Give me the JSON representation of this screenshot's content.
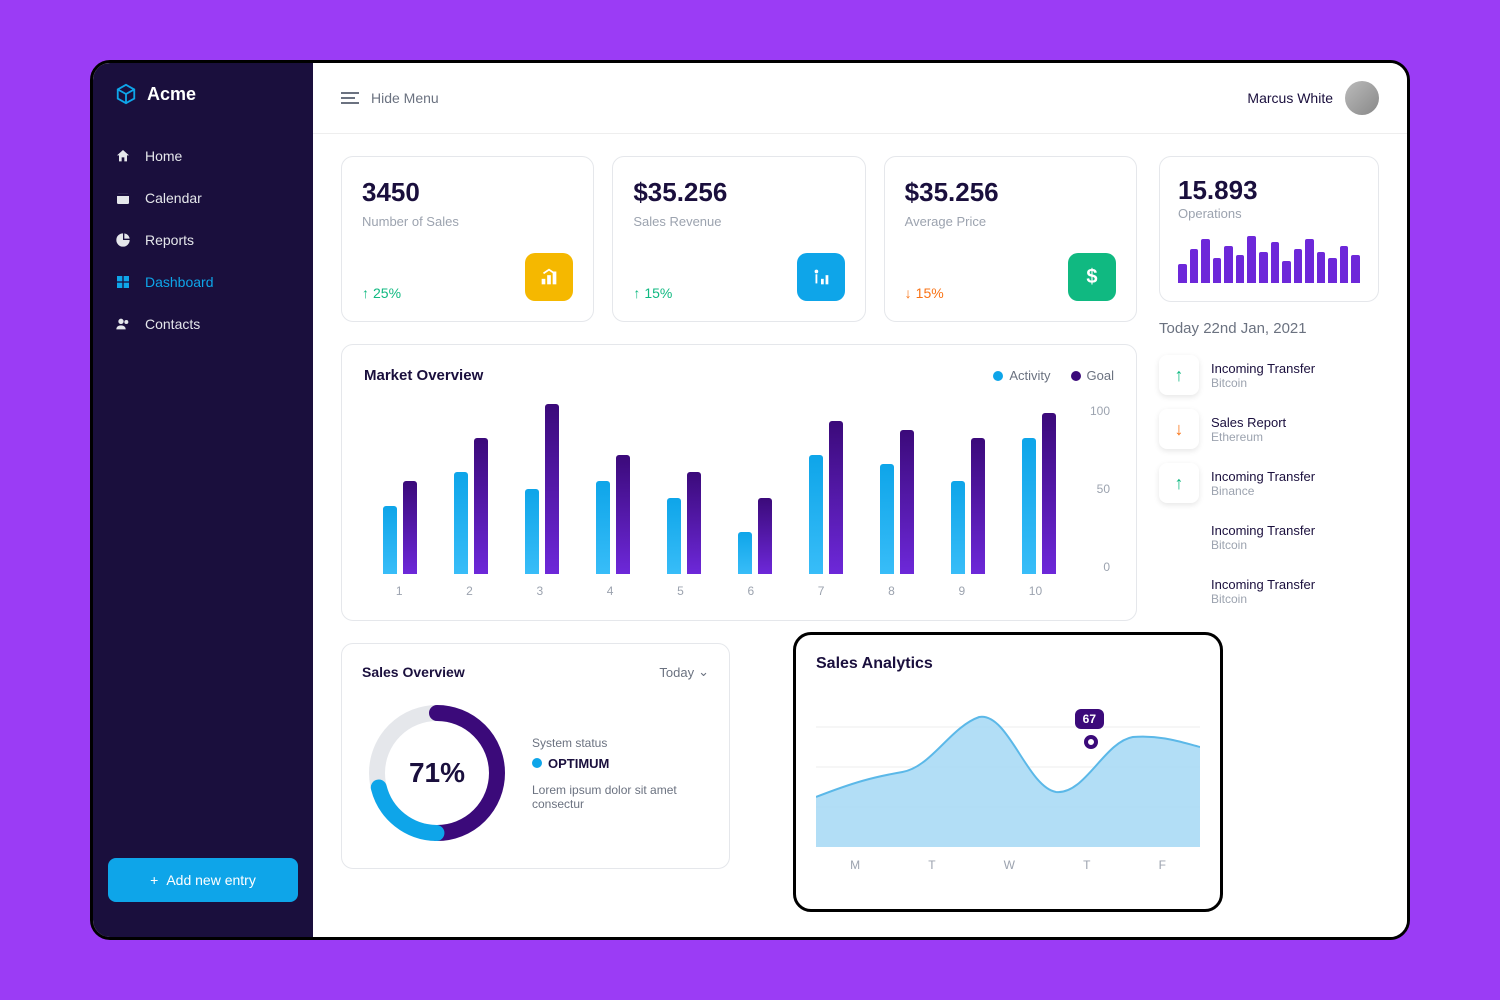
{
  "brand": "Acme",
  "hide_menu": "Hide Menu",
  "user_name": "Marcus White",
  "nav": {
    "home": "Home",
    "calendar": "Calendar",
    "reports": "Reports",
    "dashboard": "Dashboard",
    "contacts": "Contacts"
  },
  "add_button": "Add new entry",
  "cards": [
    {
      "value": "3450",
      "label": "Number of Sales",
      "trend": "25%",
      "trend_dir": "up",
      "icon_bg": "#f5b800"
    },
    {
      "value": "$35.256",
      "label": "Sales Revenue",
      "trend": "15%",
      "trend_dir": "up",
      "icon_bg": "#0ea5e9"
    },
    {
      "value": "$35.256",
      "label": "Average Price",
      "trend": "15%",
      "trend_dir": "down",
      "icon_bg": "#10b981"
    }
  ],
  "market": {
    "title": "Market Overview",
    "legend": {
      "activity": "Activity",
      "goal": "Goal"
    }
  },
  "sales_overview": {
    "title": "Sales Overview",
    "dropdown": "Today",
    "percent": "71%",
    "system_status": "System status",
    "status": "OPTIMUM",
    "desc": "Lorem ipsum dolor sit amet consectur"
  },
  "analytics": {
    "title": "Sales Analytics",
    "tooltip": "67",
    "xaxis": [
      "M",
      "T",
      "W",
      "T",
      "F"
    ]
  },
  "right": {
    "operations": {
      "value": "15.893",
      "label": "Operations"
    },
    "date": "Today 22nd Jan, 2021",
    "activities": [
      {
        "title": "Incoming Transfer",
        "sub": "Bitcoin",
        "dir": "up"
      },
      {
        "title": "Sales Report",
        "sub": "Ethereum",
        "dir": "down"
      },
      {
        "title": "Incoming Transfer",
        "sub": "Binance",
        "dir": "up"
      },
      {
        "title": "Incoming Transfer",
        "sub": "Bitcoin",
        "dir": "none"
      },
      {
        "title": "Incoming Transfer",
        "sub": "Bitcoin",
        "dir": "none"
      }
    ]
  },
  "chart_data": [
    {
      "type": "bar",
      "title": "Market Overview",
      "categories": [
        "1",
        "2",
        "3",
        "4",
        "5",
        "6",
        "7",
        "8",
        "9",
        "10"
      ],
      "series": [
        {
          "name": "Activity",
          "values": [
            40,
            60,
            50,
            55,
            45,
            25,
            70,
            65,
            55,
            80
          ]
        },
        {
          "name": "Goal",
          "values": [
            55,
            80,
            100,
            70,
            60,
            45,
            90,
            85,
            80,
            95
          ]
        }
      ],
      "ylim": [
        0,
        100
      ],
      "yticks": [
        0,
        50,
        100
      ]
    },
    {
      "type": "bar",
      "title": "Operations",
      "values": [
        30,
        55,
        70,
        40,
        60,
        45,
        75,
        50,
        65,
        35,
        55,
        70,
        50,
        40,
        60,
        45
      ]
    },
    {
      "type": "pie",
      "title": "Sales Overview",
      "values": [
        71,
        29
      ]
    },
    {
      "type": "area",
      "title": "Sales Analytics",
      "categories": [
        "M",
        "T",
        "W",
        "T",
        "F"
      ],
      "values": [
        42,
        50,
        80,
        45,
        67
      ],
      "highlight": {
        "x": "T",
        "y": 67
      }
    }
  ]
}
